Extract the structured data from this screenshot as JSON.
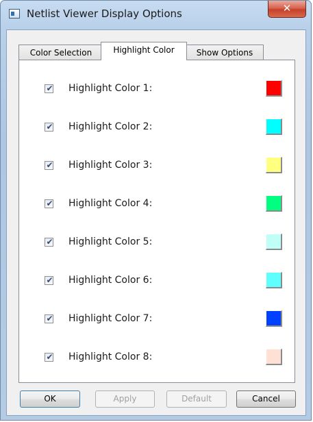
{
  "window": {
    "title": "Netlist Viewer Display Options",
    "close_glyph": "✕"
  },
  "tabs": [
    {
      "label": "Color Selection",
      "active": false
    },
    {
      "label": "Highlight Color",
      "active": true
    },
    {
      "label": "Show Options",
      "active": false
    }
  ],
  "highlight_rows": [
    {
      "label": "Highlight Color 1:",
      "checked": true,
      "color": "#ff0000"
    },
    {
      "label": "Highlight Color 2:",
      "checked": true,
      "color": "#00ffff"
    },
    {
      "label": "Highlight Color 3:",
      "checked": true,
      "color": "#ffff80"
    },
    {
      "label": "Highlight Color 4:",
      "checked": true,
      "color": "#00ff80"
    },
    {
      "label": "Highlight Color 5:",
      "checked": true,
      "color": "#c0fff8"
    },
    {
      "label": "Highlight Color 6:",
      "checked": true,
      "color": "#60ffff"
    },
    {
      "label": "Highlight Color 7:",
      "checked": true,
      "color": "#0040ff"
    },
    {
      "label": "Highlight Color 8:",
      "checked": true,
      "color": "#ffe0d4"
    }
  ],
  "checkbox_glyph": "✔",
  "buttons": {
    "ok": "OK",
    "apply": "Apply",
    "default": "Default",
    "cancel": "Cancel"
  },
  "icons": {
    "app": "window-app-icon",
    "close": "close-icon"
  }
}
